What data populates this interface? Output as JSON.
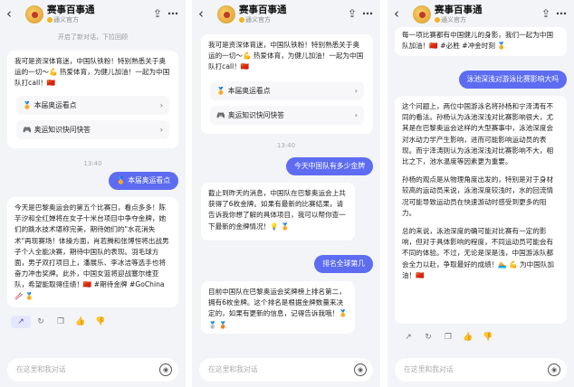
{
  "app": {
    "title": "赛事百事通",
    "subtitle": "通义官方",
    "back_icon": "chevron-left-icon",
    "share_icon": "share-icon",
    "more_icon": "more-icon",
    "input_placeholder": "在这里和我对话",
    "mic_icon": "voice-icon"
  },
  "panel1": {
    "notice": "开启了新对话，下拉回顾",
    "intro": "我可是资深体育迷，中国队铁粉！特别熟悉关于奥运的一切～💪 热爱体育，为健儿加油！一起为中国队打call！🇨🇳",
    "options": [
      {
        "glyph": "🏅",
        "label": "本届奥运看点"
      },
      {
        "glyph": "🎮",
        "label": "奥运知识快问快答"
      }
    ],
    "time": "13:40",
    "user_message": {
      "glyph": "🏅",
      "label": "本届奥运看点"
    },
    "answer": "今天是巴黎奥运会的第五个比赛日，看点多多！陈芋汐和全红婵将在女子十米台项目中争夺金牌，她们的跳水技术堪称完美，期待她们的\"水花消失术\"再现赛场！体操方面，肖若腾和张博恒将出战男子个人全能决赛，期待中国队的表现。羽毛球方面，男子双打项目上，潘展乐、李冰洁等选手也将奋力冲击奖牌。此外，中国女篮将迎战塞尔维亚队，希望能取得佳绩！🇨🇳 #期待金牌 #GoChina 🥢 🏅"
  },
  "panel2": {
    "intro": "我可是资深体育迷，中国队铁粉！特别熟悉关于奥运的一切～💪 热爱体育，为健儿加油！一起为中国队打call！🇨🇳",
    "options": [
      {
        "glyph": "🏅",
        "label": "本届奥运看点"
      },
      {
        "glyph": "🎮",
        "label": "奥运知识快问快答"
      }
    ],
    "time": "13:40",
    "user_message_1": "今天中国队有多少金牌",
    "answer_1": "截止到昨天的消息，中国队在巴黎奥运会上共获得了6枚金牌。如果有最新的比赛结果，请告诉我你想了解的具体项目，我可以帮你查一下最新的金牌情况！💡 🏅",
    "user_message_2": "排名全球第几",
    "answer_2": "目前中国队在巴黎奥运会奖牌榜上排名第二，拥有6枚金牌。这个排名是根据金牌数量来决定的，如果有更新的信息，记得告诉我哦！🏅 🥈 🥉"
  },
  "panel3": {
    "top_text": "每一项比赛都有中国健儿的身影，我们一起为中国队加油！🇨🇳 #必胜 #冲金时刻 🏅",
    "user_message": "泳池深浅对游泳比赛影响大吗",
    "paragraphs": [
      "这个问题上，两位中国游泳名将孙杨和宁泽涛有不同的看法。孙杨认为泳池深浅对比赛影响很大，尤其是在巴黎奥运会这样的大型赛事中，泳池深度会对水动力学产生影响，进而可能影响运动员的表现。而宁泽涛则认为泳池深浅对比赛影响不大，相比之下，池水温度等因素更为重要。",
      "孙杨的观点是从物理角度出发的，特别是对于身材较高的运动员来说，泳池深度较浅时，水的回流情况可能导致运动员在快速游动时感受到更多的阻力。",
      "总的来说，泳池深度的确可能对比赛有一定的影响，但对于具体影响的程度，不同运动员可能会有不同的体验。不过，无论是深是浅，中国游泳队都会全力以赴，争取最好的成绩！🏊 💪 为中国队加油！🇨🇳"
    ]
  },
  "actions": [
    {
      "icon": "share-icon",
      "glyph": "↗"
    },
    {
      "icon": "refresh-icon",
      "glyph": "↻"
    },
    {
      "icon": "copy-icon",
      "glyph": "❐"
    },
    {
      "icon": "thumbs-up-icon",
      "glyph": "👍"
    },
    {
      "icon": "thumbs-down-icon",
      "glyph": "👎"
    }
  ],
  "colors": {
    "accent": "#5d6cf1",
    "background": "#f3f4f8",
    "card": "#ffffff"
  }
}
